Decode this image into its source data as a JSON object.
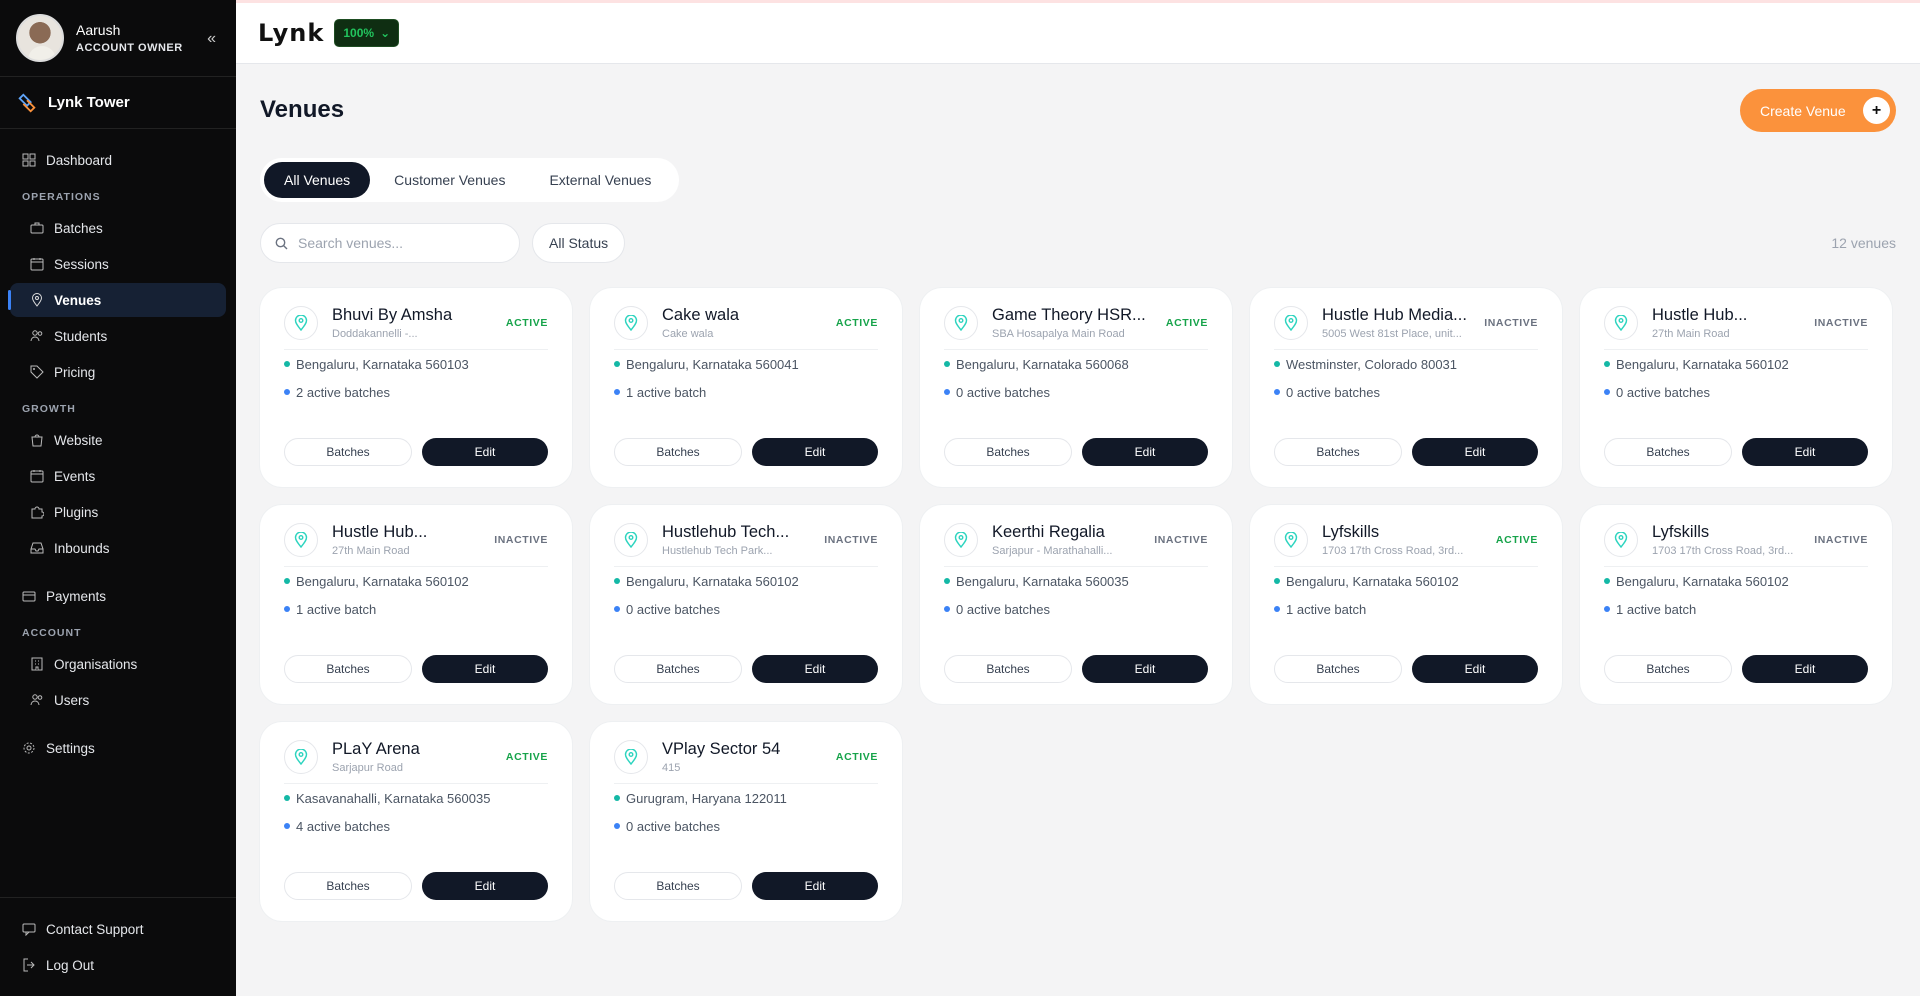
{
  "sidebar": {
    "user_name": "Aarush",
    "user_role": "ACCOUNT OWNER",
    "brand_name": "Lynk Tower",
    "items": {
      "dashboard": "Dashboard",
      "operations": "OPERATIONS",
      "batches": "Batches",
      "sessions": "Sessions",
      "venues": "Venues",
      "students": "Students",
      "pricing": "Pricing",
      "growth": "GROWTH",
      "website": "Website",
      "events": "Events",
      "plugins": "Plugins",
      "inbounds": "Inbounds",
      "payments": "Payments",
      "account": "ACCOUNT",
      "organisations": "Organisations",
      "users": "Users",
      "settings": "Settings"
    },
    "footer": {
      "contact_support": "Contact Support",
      "log_out": "Log Out"
    }
  },
  "topbar": {
    "logo": "Lynk",
    "zoom": "100%"
  },
  "main": {
    "title": "Venues",
    "create_label": "Create Venue",
    "tabs": [
      "All Venues",
      "Customer Venues",
      "External Venues"
    ],
    "search_placeholder": "Search venues...",
    "status_filter": "All Status",
    "count": "12 venues",
    "batches_label": "Batches",
    "edit_label": "Edit"
  },
  "venues": [
    {
      "name": "Bhuvi By Amsha",
      "sub": "Doddakannelli -...",
      "status": "ACTIVE",
      "location": "Bengaluru, Karnataka 560103",
      "batches": "2 active batches"
    },
    {
      "name": "Cake wala",
      "sub": "Cake wala",
      "status": "ACTIVE",
      "location": "Bengaluru, Karnataka 560041",
      "batches": "1 active batch"
    },
    {
      "name": "Game Theory HSR...",
      "sub": "SBA Hosapalya Main Road",
      "status": "ACTIVE",
      "location": "Bengaluru, Karnataka 560068",
      "batches": "0 active batches"
    },
    {
      "name": "Hustle Hub Media...",
      "sub": "5005 West 81st Place, unit...",
      "status": "INACTIVE",
      "location": "Westminster, Colorado 80031",
      "batches": "0 active batches"
    },
    {
      "name": "Hustle Hub...",
      "sub": "27th Main Road",
      "status": "INACTIVE",
      "location": "Bengaluru, Karnataka 560102",
      "batches": "0 active batches"
    },
    {
      "name": "Hustle Hub...",
      "sub": "27th Main Road",
      "status": "INACTIVE",
      "location": "Bengaluru, Karnataka 560102",
      "batches": "1 active batch"
    },
    {
      "name": "Hustlehub Tech...",
      "sub": "Hustlehub Tech Park...",
      "status": "INACTIVE",
      "location": "Bengaluru, Karnataka 560102",
      "batches": "0 active batches"
    },
    {
      "name": "Keerthi Regalia",
      "sub": "Sarjapur - Marathahalli...",
      "status": "INACTIVE",
      "location": "Bengaluru, Karnataka 560035",
      "batches": "0 active batches"
    },
    {
      "name": "Lyfskills",
      "sub": "1703 17th Cross Road, 3rd...",
      "status": "ACTIVE",
      "location": "Bengaluru, Karnataka 560102",
      "batches": "1 active batch"
    },
    {
      "name": "Lyfskills",
      "sub": "1703 17th Cross Road, 3rd...",
      "status": "INACTIVE",
      "location": "Bengaluru, Karnataka 560102",
      "batches": "1 active batch"
    },
    {
      "name": "PLaY Arena",
      "sub": "Sarjapur Road",
      "status": "ACTIVE",
      "location": "Kasavanahalli, Karnataka 560035",
      "batches": "4 active batches"
    },
    {
      "name": "VPlay Sector 54",
      "sub": "415",
      "status": "ACTIVE",
      "location": "Gurugram, Haryana 122011",
      "batches": "0 active batches"
    }
  ],
  "colors": {
    "accent": "#fb923c",
    "sidebar_bg": "#0b0b0c",
    "active_green": "#16a34a",
    "dark_button": "#111827"
  }
}
